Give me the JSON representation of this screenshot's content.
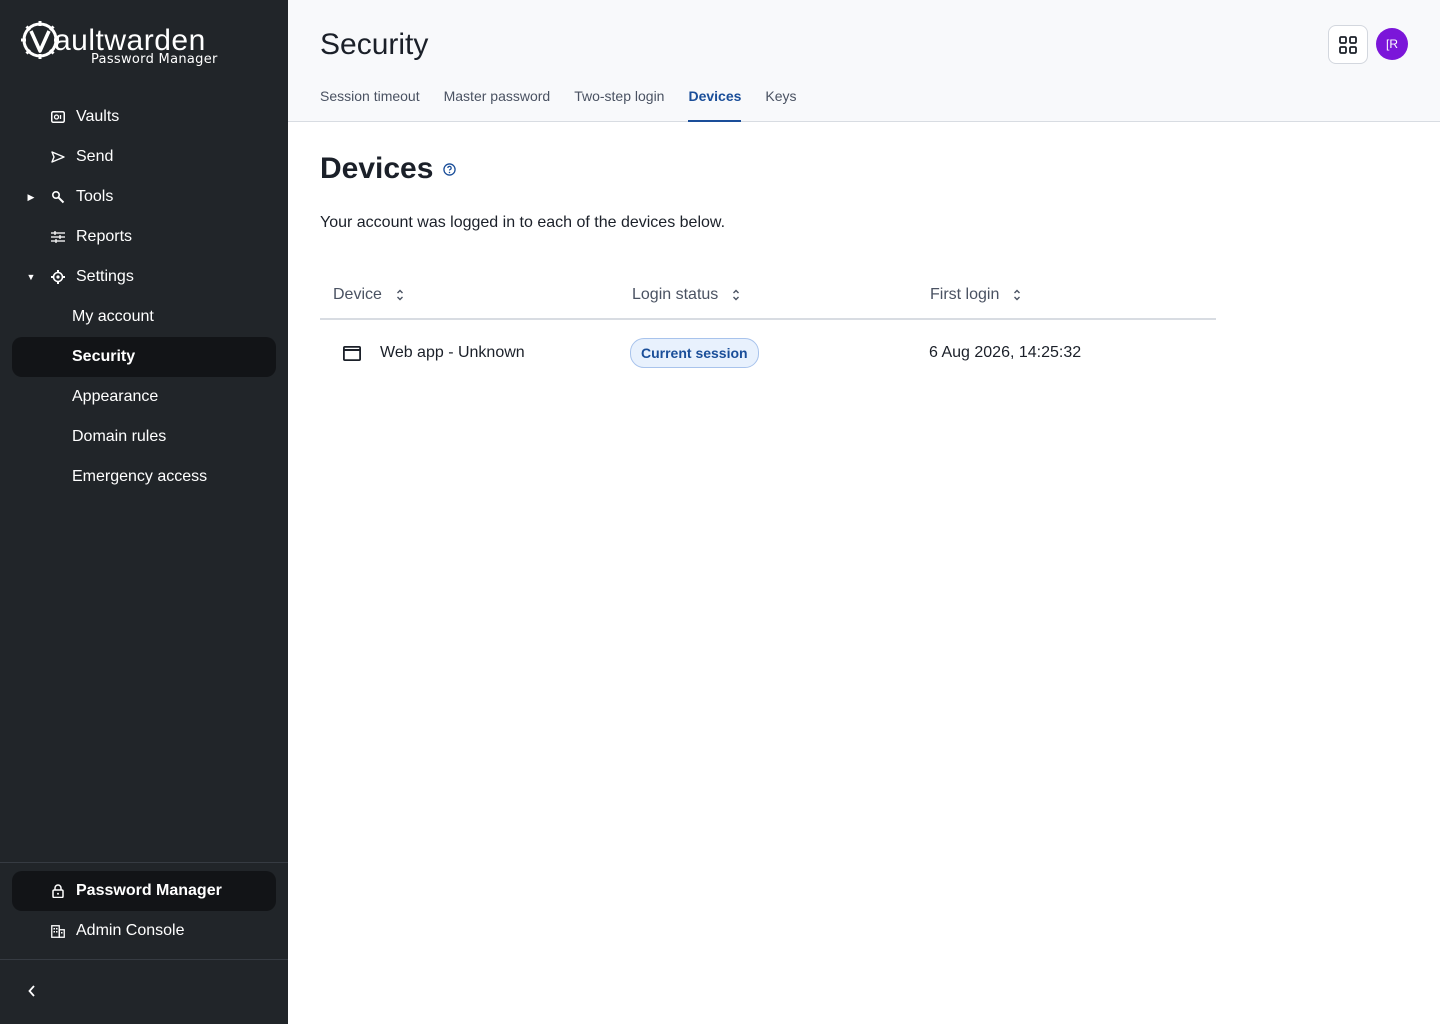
{
  "sidebar": {
    "logo_word": "aultwarden",
    "logo_sub": "Password Manager",
    "items": [
      {
        "label": "Vaults",
        "icon": "vault-icon"
      },
      {
        "label": "Send",
        "icon": "send-icon"
      },
      {
        "label": "Tools",
        "icon": "wrench-icon"
      },
      {
        "label": "Reports",
        "icon": "sliders-icon"
      },
      {
        "label": "Settings",
        "icon": "gear-icon"
      },
      {
        "label": "My account"
      },
      {
        "label": "Security"
      },
      {
        "label": "Appearance"
      },
      {
        "label": "Domain rules"
      },
      {
        "label": "Emergency access"
      }
    ],
    "bottom_items": [
      {
        "label": "Password Manager",
        "icon": "lock-icon"
      },
      {
        "label": "Admin Console",
        "icon": "building-icon"
      }
    ]
  },
  "header": {
    "title": "Security",
    "tabs": [
      "Session timeout",
      "Master password",
      "Two-step login",
      "Devices",
      "Keys"
    ],
    "active_tab": "Devices",
    "avatar_initials": "[R"
  },
  "main": {
    "title": "Devices",
    "description": "Your account was logged in to each of the devices below.",
    "columns": [
      "Device",
      "Login status",
      "First login"
    ],
    "rows": [
      {
        "device": "Web app - Unknown",
        "status": "Current session",
        "first_login": "6 Aug 2026, 14:25:32"
      }
    ]
  },
  "colors": {
    "sidebar_bg": "#212529",
    "active_bg": "#121417",
    "accent": "#1a4e99",
    "avatar": "#7b16d9"
  }
}
